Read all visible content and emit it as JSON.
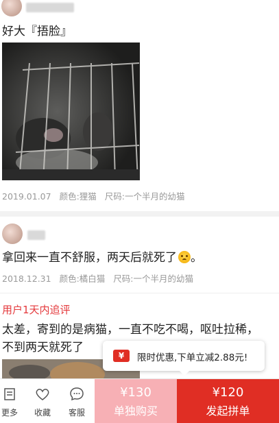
{
  "reviews": [
    {
      "text": "好大『捂脸』",
      "date": "2019.01.07",
      "color": "颜色:狸猫",
      "size": "尺码:一个半月的幼猫"
    },
    {
      "text": "拿回来一直不舒服，两天后就死了",
      "text_suffix": "。",
      "emoji": "sad-face-icon",
      "date": "2018.12.31",
      "color": "颜色:橘白猫",
      "size": "尺码:一个半月的幼猫"
    },
    {
      "followup_title": "用户1天内追评",
      "followup_line1": "太差，寄到的是病猫，一直不吃不喝，呕吐拉稀，",
      "followup_line2": "不到两天就死了"
    }
  ],
  "tooltip": {
    "icon": "coupon-icon",
    "icon_glyph": "¥",
    "text": "限时优惠,下单立减2.88元!"
  },
  "bottom_bar": {
    "more": "更多",
    "favorite": "收藏",
    "service": "客服",
    "solo_price": "¥130",
    "solo_label": "单独购买",
    "group_price": "¥120",
    "group_label": "发起拼单"
  },
  "colors": {
    "accent": "#e02e24",
    "accent_light": "#f7b0b5"
  }
}
